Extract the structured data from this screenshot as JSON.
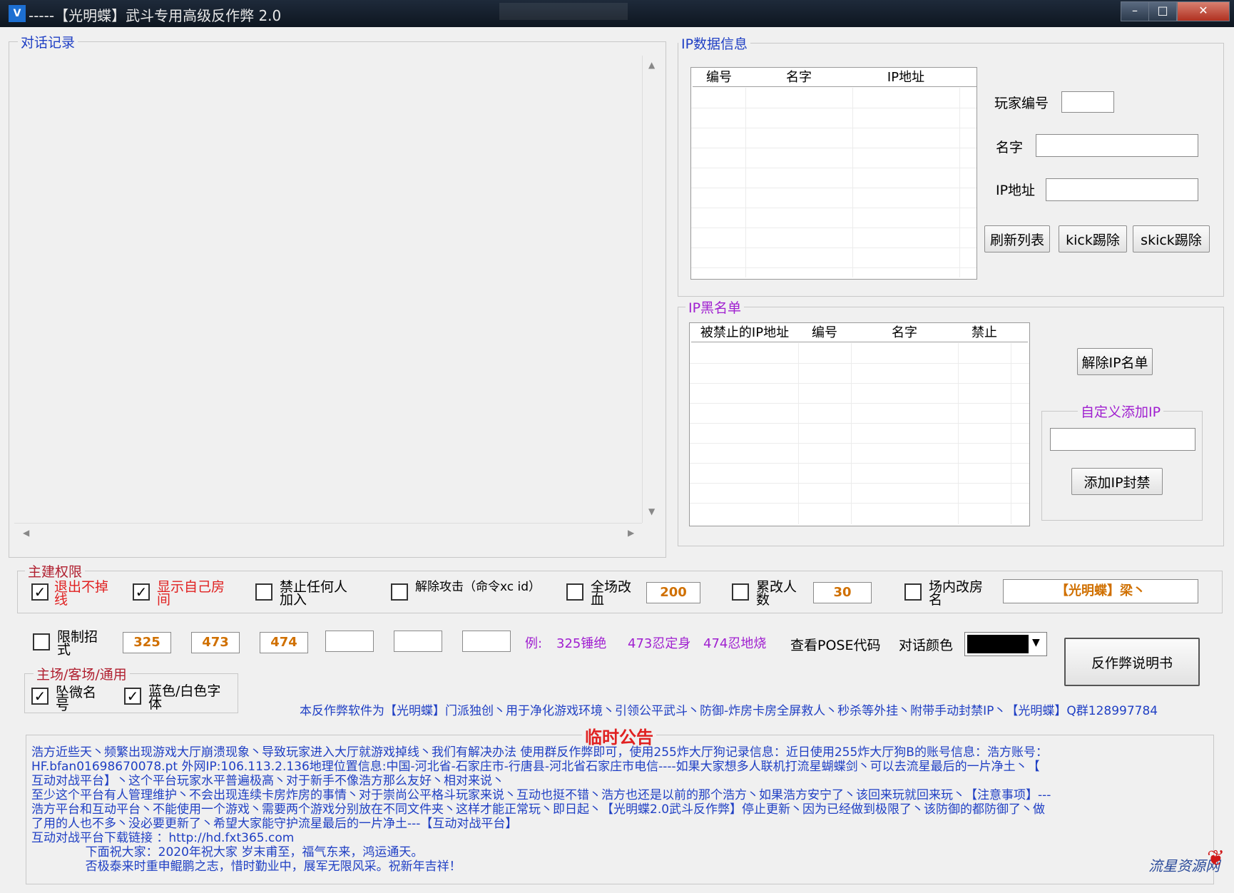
{
  "window": {
    "title": "-----【光明蝶】武斗专用高级反作弊 2.0",
    "app_icon": "V"
  },
  "chat_group": {
    "legend": "对话记录"
  },
  "ip_group": {
    "legend": "IP数据信息",
    "columns": [
      "编号",
      "名字",
      "IP地址"
    ],
    "player_id_label": "玩家编号",
    "name_label": "名字",
    "ip_label": "IP地址",
    "refresh_button": "刷新列表",
    "kick_button": "kick踢除",
    "skick_button": "skick踢除"
  },
  "blacklist_group": {
    "legend": "IP黑名单",
    "columns": [
      "被禁止的IP地址",
      "编号",
      "名字",
      "禁止"
    ],
    "remove_button": "解除IP名单",
    "custom_legend": "自定义添加IP",
    "add_button": "添加IP封禁"
  },
  "host_group": {
    "legend": "主建权限",
    "options": [
      {
        "label": "退出不掉线",
        "checked": true
      },
      {
        "label": "显示自己房间",
        "checked": true
      },
      {
        "label": "禁止任何人加入",
        "checked": false
      },
      {
        "label": "解除攻击（命令xc id）",
        "checked": false
      },
      {
        "label": "全场改血",
        "checked": false
      },
      {
        "label": "累改人数",
        "checked": false
      },
      {
        "label": "场内改房名",
        "checked": false
      }
    ],
    "hp_value": "200",
    "count_value": "30",
    "room_name": "【光明蝶】梁丶"
  },
  "limit": {
    "label": "限制招式",
    "checked": false,
    "values": [
      "325",
      "473",
      "474",
      "",
      "",
      ""
    ],
    "examples": [
      "例:",
      "325锤绝",
      "473忍定身",
      "474忍地烧"
    ],
    "view_pose": "查看POSE代码",
    "chat_color_label": "对话颜色",
    "chat_color": "#000000",
    "manual_button": "反作弊说明书"
  },
  "scene_group": {
    "legend": "主场/客场/通用",
    "options": [
      {
        "label": "坠微名号",
        "checked": true
      },
      {
        "label": "蓝色/白色字体",
        "checked": true
      }
    ]
  },
  "banner": "本反作弊软件为【光明蝶】门派独创丶用于净化游戏环境丶引领公平武斗丶防御-炸房卡房全屏救人丶秒杀等外挂丶附带手动封禁IP丶【光明蝶】Q群128997784",
  "notice": {
    "title": "临时公告",
    "lines": [
      "浩方近些天丶频繁出现游戏大厅崩溃现象丶导致玩家进入大厅就游戏掉线丶我们有解决办法 使用群反作弊即可，使用255炸大厅狗记录信息：近日使用255炸大厅狗B的账号信息：浩方账号：",
      "HF.bfan01698670078.pt 外网IP:106.113.2.136地理位置信息:中国-河北省-石家庄市-行唐县-河北省石家庄市电信----如果大家想多人联机打流星蝴蝶剑丶可以去流星最后的一片净土丶【",
      "互动对战平台】丶这个平台玩家水平普遍极高丶对于新手不像浩方那么友好丶相对来说丶",
      "至少这个平台有人管理维护丶不会出现连续卡房炸房的事情丶对于崇尚公平格斗玩家来说丶互动也挺不错丶浩方也还是以前的那个浩方丶如果浩方安宁了丶该回来玩就回来玩丶【注意事项】---",
      "浩方平台和互动平台丶不能使用一个游戏丶需要两个游戏分别放在不同文件夹丶这样才能正常玩丶即日起丶【光明蝶2.0武斗反作弊】停止更新丶因为已经做到极限了丶该防御的都防御了丶做",
      "了用的人也不多丶没必要更新了丶希望大家能守护流星最后的一片净土---【互动对战平台】",
      "互动对战平台下载链接 ：http://hd.fxt365.com",
      "              下面祝大家：2020年祝大家 岁末甫至，福气东来，鸿运通天。",
      "              否极泰来时重申鲲鹏之志，惜时勤业中，展军无限风采。祝新年吉祥！"
    ]
  },
  "watermark": "流星资源网"
}
